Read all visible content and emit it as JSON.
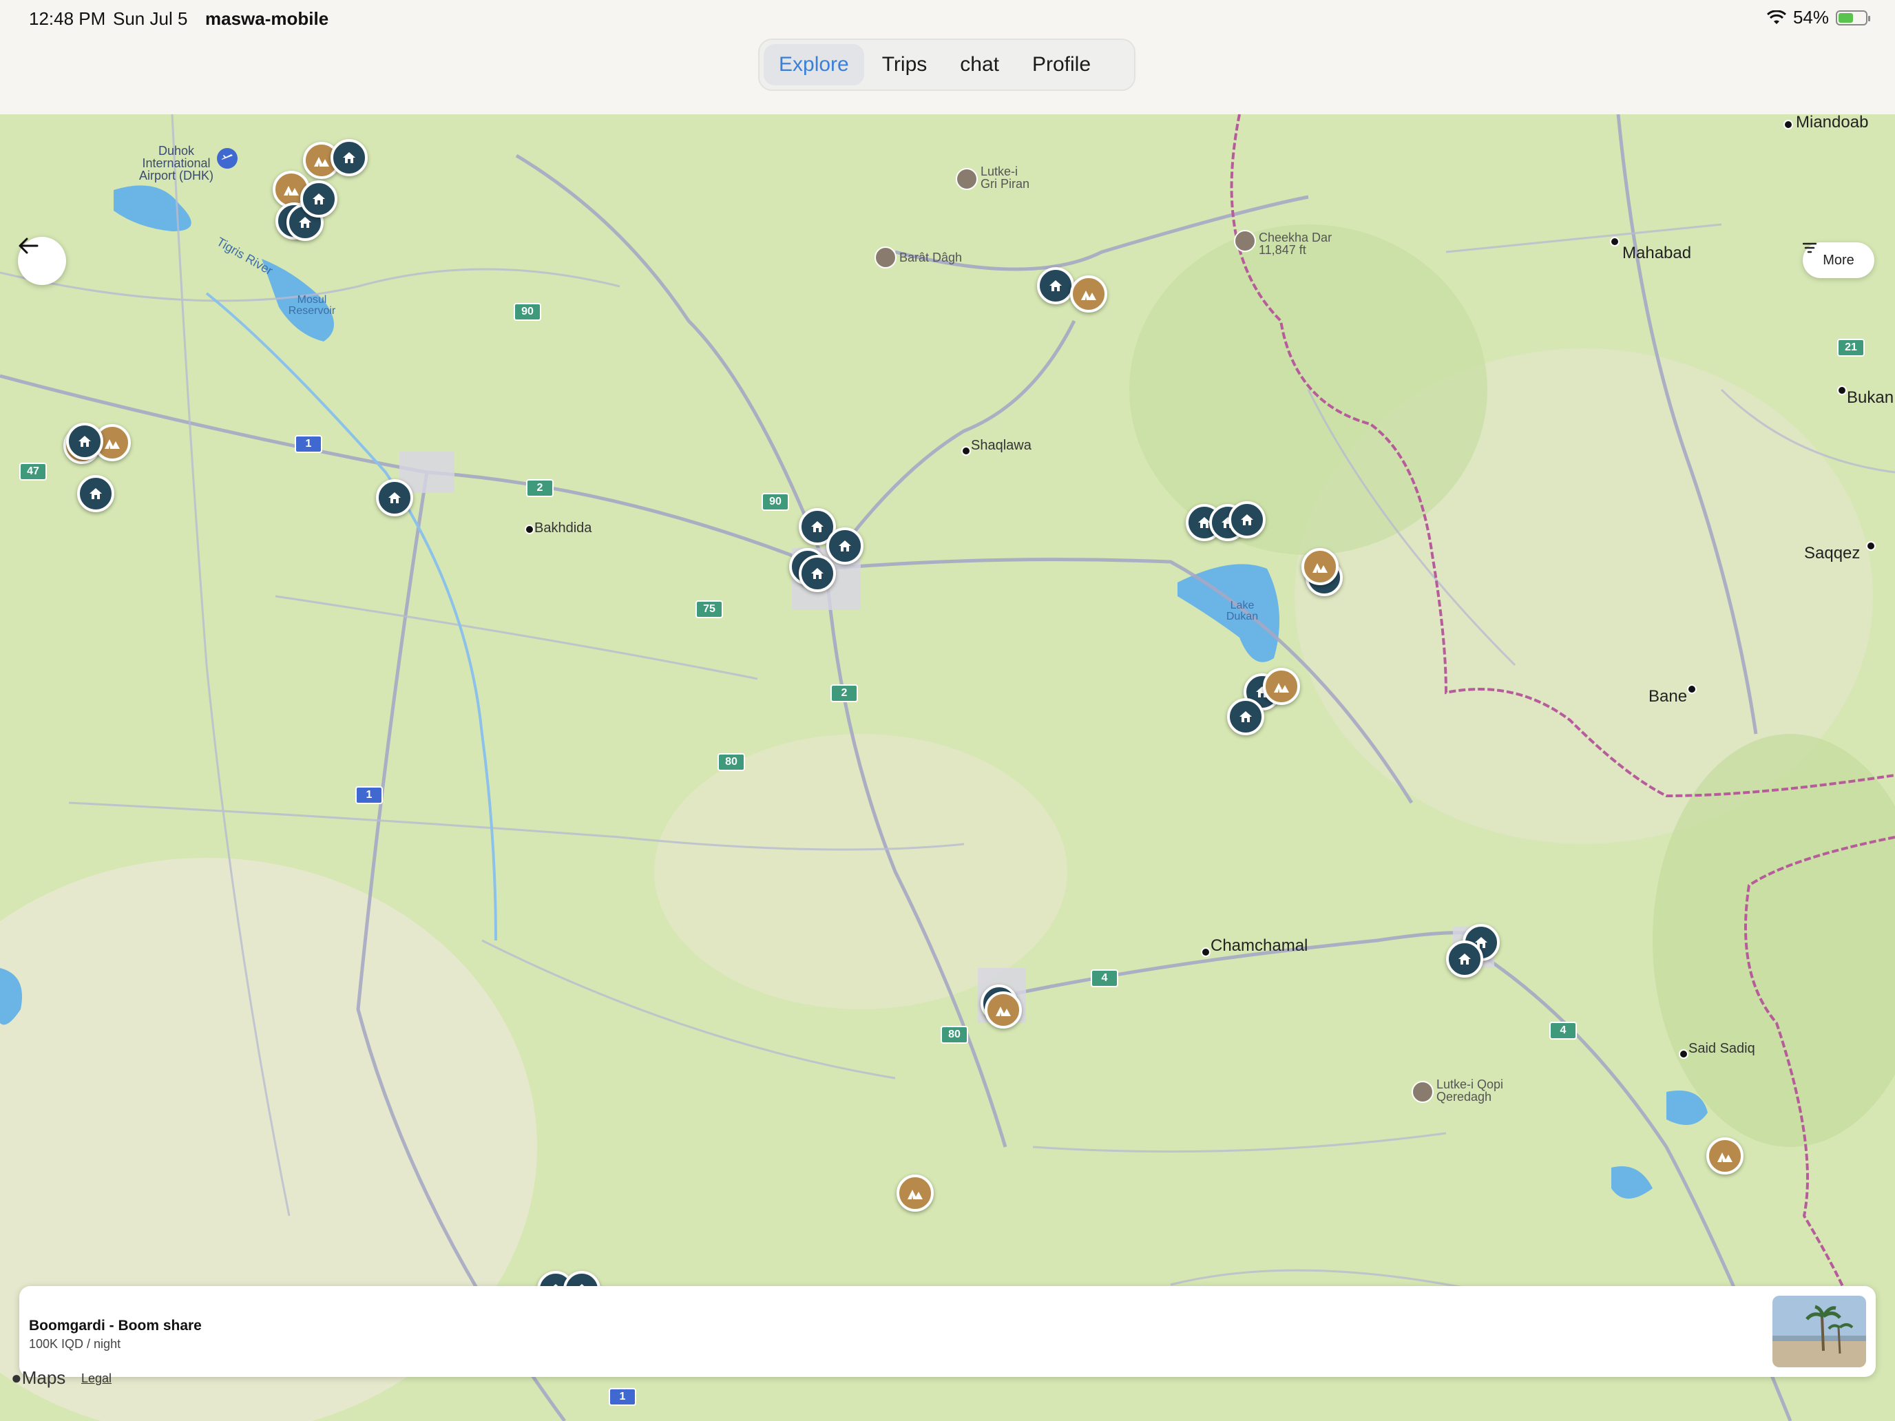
{
  "status_bar": {
    "time": "12:48 PM",
    "date": "Sun Jul 5",
    "app_name": "maswa-mobile",
    "battery": "54%",
    "battery_level": 0.54,
    "icons": [
      "wifi-icon",
      "battery-icon"
    ]
  },
  "tabs": [
    {
      "label": "Explore",
      "active": true
    },
    {
      "label": "Trips",
      "active": false
    },
    {
      "label": "chat",
      "active": false
    },
    {
      "label": "Profile",
      "active": false
    }
  ],
  "controls": {
    "back_icon": "arrow-left-icon",
    "more_label": "More",
    "more_icon": "filter-icon"
  },
  "map_labels": {
    "duhok_airport": "Duhok International Airport (DHK)",
    "tigris": "Tigris River",
    "mosul_reservoir": "Mosul Reservoir",
    "lutke_gri_piran": "Lutke-i Gri Piran",
    "barat_dagh": "Barât Dâgh",
    "cheekha_dar": "Cheekha Dar 11,847 ft",
    "miandoab": "Miandoab",
    "mahabad": "Mahabad",
    "bukan": "Bukan",
    "shaqlawa": "Shaqlawa",
    "bakhdida": "Bakhdida",
    "lake_dukan": "Lake Dukan",
    "saqqez": "Saqqez",
    "bane": "Bane",
    "chamchamal": "Chamchamal",
    "said_sadiq": "Said Sadiq",
    "lutke_qopi": "Lutke-i Qopi Qeredagh"
  },
  "road_shields": [
    "90",
    "1",
    "2",
    "90",
    "75",
    "2",
    "80",
    "1",
    "80",
    "4",
    "4",
    "47",
    "21",
    "1"
  ],
  "listing_card": {
    "title": "Boomgardi - Boom share",
    "price": "100K IQD / night"
  },
  "attribution": {
    "maps": "Maps",
    "legal": "Legal"
  },
  "colors": {
    "accent": "#3a7fd8",
    "house_pin": "#24475a",
    "camp_pin": "#b78a4c",
    "map_land": "#d6e7b3",
    "water": "#6ab4e6",
    "border_line": "#b75c9b"
  }
}
